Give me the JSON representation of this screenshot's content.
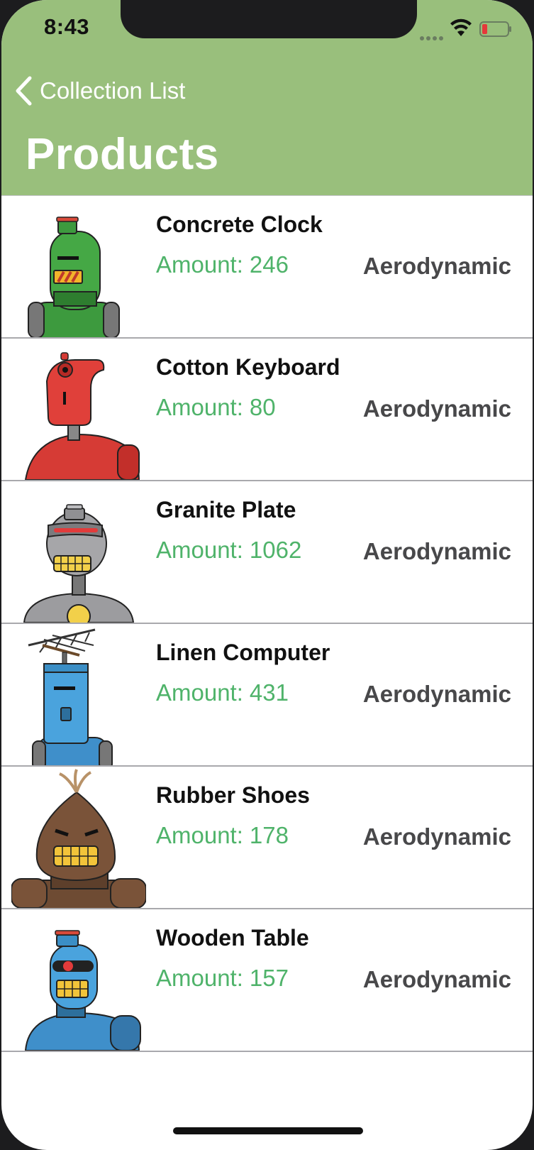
{
  "status_bar": {
    "time": "8:43",
    "wifi_icon": "wifi-icon",
    "battery_icon": "battery-low-icon",
    "battery_color": "#e5393b"
  },
  "nav": {
    "back_label": "Collection List",
    "back_icon": "chevron-left-icon",
    "title": "Products",
    "bar_color": "#99bf7c"
  },
  "products": [
    {
      "name": "Concrete Clock",
      "amount_label": "Amount:",
      "amount": "246",
      "tag": "Aerodynamic",
      "image": "green-robot-avatar"
    },
    {
      "name": "Cotton Keyboard",
      "amount_label": "Amount:",
      "amount": "80",
      "tag": "Aerodynamic",
      "image": "red-robot-avatar"
    },
    {
      "name": "Granite Plate",
      "amount_label": "Amount:",
      "amount": "1062",
      "tag": "Aerodynamic",
      "image": "gray-robot-avatar"
    },
    {
      "name": "Linen Computer",
      "amount_label": "Amount:",
      "amount": "431",
      "tag": "Aerodynamic",
      "image": "blue-antenna-robot-avatar"
    },
    {
      "name": "Rubber Shoes",
      "amount_label": "Amount:",
      "amount": "178",
      "tag": "Aerodynamic",
      "image": "brown-robot-avatar"
    },
    {
      "name": "Wooden Table",
      "amount_label": "Amount:",
      "amount": "157",
      "tag": "Aerodynamic",
      "image": "blue-cyclops-robot-avatar"
    }
  ],
  "colors": {
    "amount_text": "#4fb36a",
    "tag_text": "#48484a",
    "name_text": "#111111"
  }
}
